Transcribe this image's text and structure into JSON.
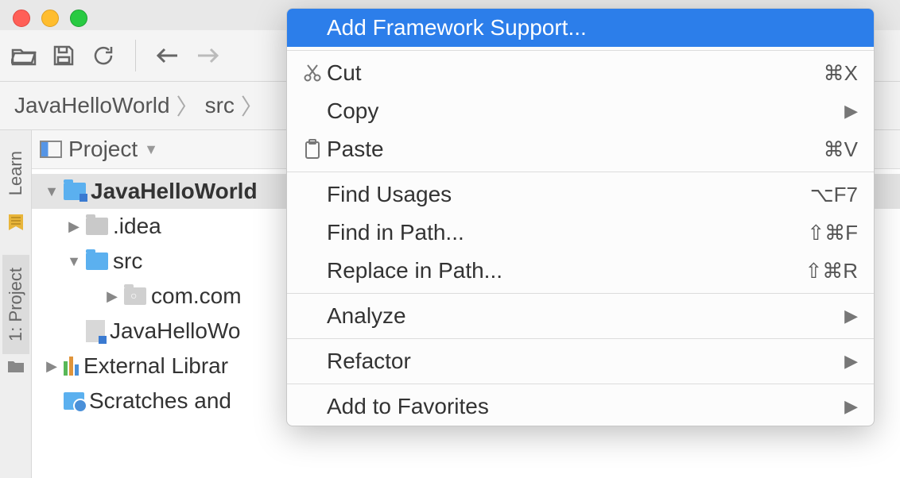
{
  "breadcrumb": {
    "project": "JavaHelloWorld",
    "folder": "src"
  },
  "panel": {
    "title": "Project"
  },
  "side_tabs": {
    "learn": "Learn",
    "project": "1: Project"
  },
  "tree": {
    "root": "JavaHelloWorld",
    "idea_folder": ".idea",
    "src_folder": "src",
    "package": "com.com",
    "iml": "JavaHelloWo",
    "external_libs": "External Librar",
    "scratches": "Scratches and"
  },
  "context_menu": {
    "add_framework": "Add Framework Support...",
    "cut": {
      "label": "Cut",
      "shortcut": "⌘X"
    },
    "copy": {
      "label": "Copy"
    },
    "paste": {
      "label": "Paste",
      "shortcut": "⌘V"
    },
    "find_usages": {
      "label": "Find Usages",
      "shortcut": "⌥F7"
    },
    "find_in_path": {
      "label": "Find in Path...",
      "shortcut": "⇧⌘F"
    },
    "replace_in_path": {
      "label": "Replace in Path...",
      "shortcut": "⇧⌘R"
    },
    "analyze": {
      "label": "Analyze"
    },
    "refactor": {
      "label": "Refactor"
    },
    "add_to_favorites": {
      "label": "Add to Favorites"
    }
  }
}
